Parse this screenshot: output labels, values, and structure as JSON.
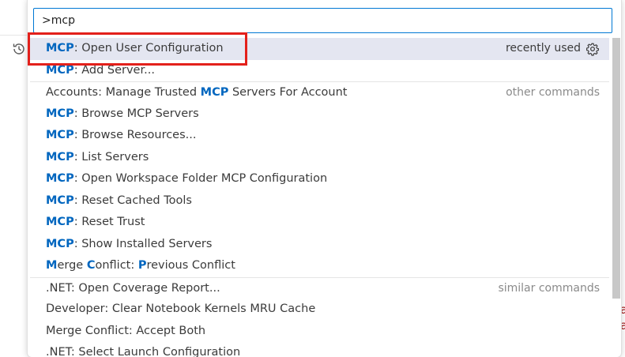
{
  "palette": {
    "input_value": ">mcp",
    "sections": {
      "recently_used": "recently used",
      "other_commands": "other commands",
      "similar_commands": "similar commands"
    },
    "items": [
      {
        "hl": "MCP",
        "rest": ": Open User Configuration",
        "right": "recently used",
        "group": "recent",
        "active": true
      },
      {
        "hl": "MCP",
        "rest": ": Add Server...",
        "right": "",
        "group": "recent"
      },
      {
        "pre": "Accounts: Manage Trusted ",
        "hl": "MCP",
        "rest": " Servers For Account",
        "right": "other commands",
        "group": "other"
      },
      {
        "hl": "MCP",
        "rest": ": Browse MCP Servers",
        "group": "other"
      },
      {
        "hl": "MCP",
        "rest": ": Browse Resources...",
        "group": "other"
      },
      {
        "hl": "MCP",
        "rest": ": List Servers",
        "group": "other"
      },
      {
        "hl": "MCP",
        "rest": ": Open Workspace Folder MCP Configuration",
        "group": "other"
      },
      {
        "hl": "MCP",
        "rest": ": Reset Cached Tools",
        "group": "other"
      },
      {
        "hl": "MCP",
        "rest": ": Reset Trust",
        "group": "other"
      },
      {
        "hl": "MCP",
        "rest": ": Show Installed Servers",
        "group": "other"
      },
      {
        "parts": [
          [
            "M",
            true
          ],
          [
            "erge ",
            false
          ],
          [
            "C",
            true
          ],
          [
            "onflict: ",
            false
          ],
          [
            "P",
            true
          ],
          [
            "revious Conflict",
            false
          ]
        ],
        "group": "other"
      },
      {
        "text": ".NET: Open Coverage Report...",
        "right": "similar commands",
        "group": "similar"
      },
      {
        "text": "Developer: Clear Notebook Kernels MRU Cache",
        "group": "similar"
      },
      {
        "text": "Merge Conflict: Accept Both",
        "group": "similar"
      },
      {
        "text": ".NET: Select Launch Configuration",
        "group": "similar"
      }
    ]
  },
  "background": {
    "edge_chars": [
      "a",
      "a"
    ]
  },
  "colors": {
    "accent": "#0078d4",
    "highlight_text": "#0066bf",
    "annotation_red": "#e3201b"
  }
}
